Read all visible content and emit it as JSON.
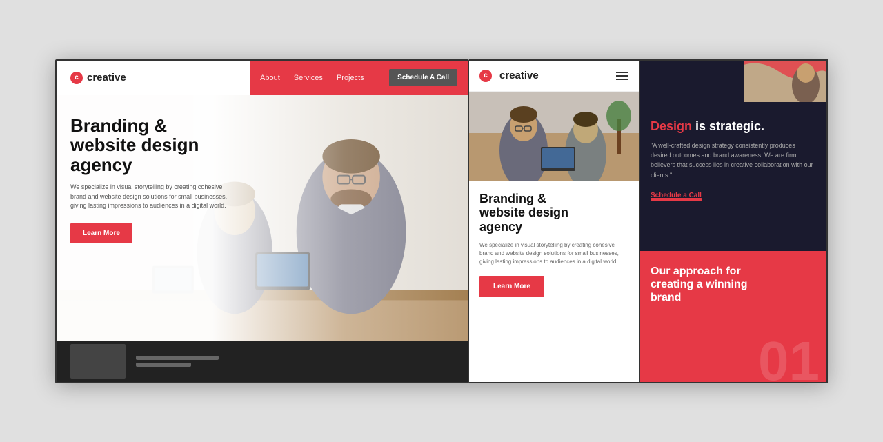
{
  "panel_desktop": {
    "logo_text": "creative",
    "nav": {
      "about": "About",
      "services": "Services",
      "projects": "Projects",
      "cta": "Schedule A Call"
    },
    "hero": {
      "heading_line1": "Branding &",
      "heading_line2": "website design",
      "heading_line3": "agency",
      "subtext": "We specialize in visual storytelling by creating cohesive brand and website design solutions for small businesses, giving lasting impressions to audiences in a digital world.",
      "btn_label": "Learn More"
    }
  },
  "panel_mobile": {
    "logo_text": "creative",
    "hero": {
      "heading_line1": "Branding &",
      "heading_line2": "website design",
      "heading_line3": "agency",
      "subtext": "We specialize in visual storytelling by creating cohesive brand and website design solutions for small businesses, giving lasting impressions to audiences in a digital world.",
      "btn_label": "Learn More"
    }
  },
  "panel_right": {
    "dark_section": {
      "headline_accent": "Design",
      "headline_rest": " is strategic.",
      "quote": "\"A well-crafted design strategy consistently produces desired outcomes and brand awareness. We are firm believers that success lies in creative collaboration with our clients.\"",
      "schedule_link": "Schedule a Call"
    },
    "red_section": {
      "heading_line1": "Our approach for",
      "heading_line2": "creating a winning",
      "heading_line3": "brand",
      "number": "01"
    }
  },
  "colors": {
    "accent": "#e63946",
    "dark": "#1a1a2e",
    "light_text": "#aaaaaa"
  }
}
